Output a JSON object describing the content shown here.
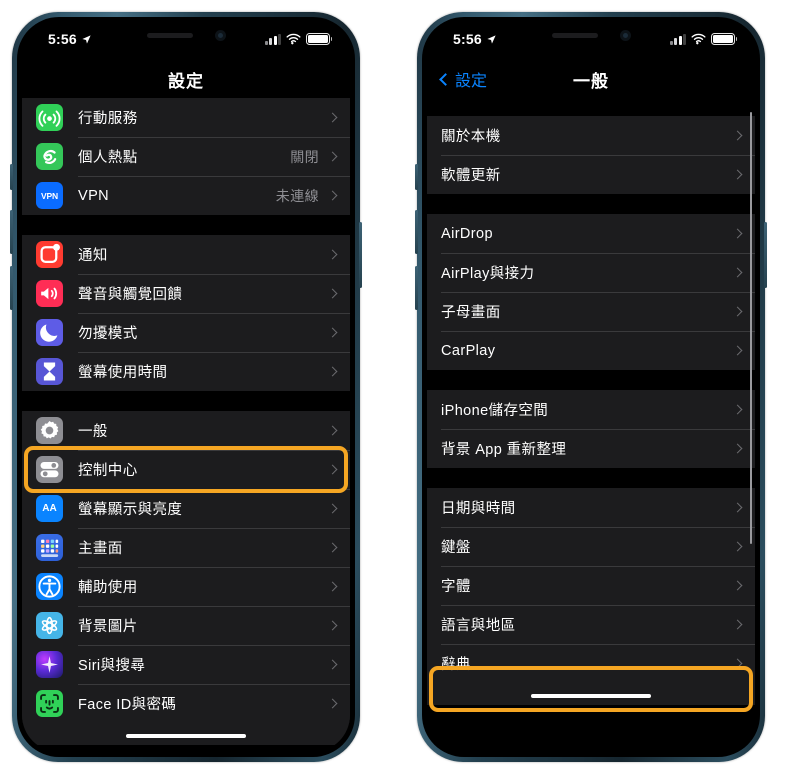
{
  "meta": {
    "platform": "ios-settings-screenshot",
    "accent_highlight_color": "#f5a623",
    "list_bg_color": "#1c1c1e",
    "link_color": "#0a84ff"
  },
  "phones": [
    {
      "id": "left-phone",
      "status_bar": {
        "time": "5:56",
        "location_arrow": "location-arrow-icon",
        "signal": "cellular-bars-icon",
        "wifi": "wifi-icon",
        "battery": "battery-icon"
      },
      "title": "設定",
      "groups": [
        {
          "rows": [
            {
              "icon": "cellular-icon",
              "label": "行動服務",
              "value": "",
              "chevron": true
            },
            {
              "icon": "hotspot-icon",
              "label": "個人熱點",
              "value": "關閉",
              "chevron": true
            },
            {
              "icon": "vpn-icon",
              "label": "VPN",
              "value": "未連線",
              "chevron": true
            }
          ]
        },
        {
          "rows": [
            {
              "icon": "notifications-icon",
              "label": "通知",
              "value": "",
              "chevron": true
            },
            {
              "icon": "sound-haptics-icon",
              "label": "聲音與觸覺回饋",
              "value": "",
              "chevron": true
            },
            {
              "icon": "do-not-disturb-icon",
              "label": "勿擾模式",
              "value": "",
              "chevron": true
            },
            {
              "icon": "screen-time-icon",
              "label": "螢幕使用時間",
              "value": "",
              "chevron": true
            }
          ]
        },
        {
          "rows": [
            {
              "icon": "general-gear-icon",
              "label": "一般",
              "value": "",
              "chevron": true,
              "highlighted": true
            },
            {
              "icon": "control-center-icon",
              "label": "控制中心",
              "value": "",
              "chevron": true
            },
            {
              "icon": "display-brightness-icon",
              "label": "螢幕顯示與亮度",
              "value": "",
              "chevron": true
            },
            {
              "icon": "home-screen-icon",
              "label": "主畫面",
              "value": "",
              "chevron": true
            },
            {
              "icon": "accessibility-icon",
              "label": "輔助使用",
              "value": "",
              "chevron": true
            },
            {
              "icon": "wallpaper-icon",
              "label": "背景圖片",
              "value": "",
              "chevron": true
            },
            {
              "icon": "siri-icon",
              "label": "Siri與搜尋",
              "value": "",
              "chevron": true
            },
            {
              "icon": "face-id-icon",
              "label": "Face ID與密碼",
              "value": "",
              "chevron": true
            }
          ]
        }
      ]
    },
    {
      "id": "right-phone",
      "status_bar": {
        "time": "5:56",
        "location_arrow": "location-arrow-icon",
        "signal": "cellular-bars-icon",
        "wifi": "wifi-icon",
        "battery": "battery-icon"
      },
      "nav": {
        "back_label": "設定",
        "title": "一般"
      },
      "groups": [
        {
          "rows": [
            {
              "label": "關於本機",
              "chevron": true
            },
            {
              "label": "軟體更新",
              "chevron": true
            }
          ]
        },
        {
          "rows": [
            {
              "label": "AirDrop",
              "chevron": true
            },
            {
              "label": "AirPlay與接力",
              "chevron": true
            },
            {
              "label": "子母畫面",
              "chevron": true
            },
            {
              "label": "CarPlay",
              "chevron": true
            }
          ]
        },
        {
          "rows": [
            {
              "label": "iPhone儲存空間",
              "chevron": true
            },
            {
              "label": "背景 App 重新整理",
              "chevron": true
            }
          ]
        },
        {
          "rows": [
            {
              "label": "日期與時間",
              "chevron": true
            },
            {
              "label": "鍵盤",
              "chevron": true
            },
            {
              "label": "字體",
              "chevron": true
            },
            {
              "label": "語言與地區",
              "chevron": true,
              "highlighted": true
            },
            {
              "label": "辭典",
              "chevron": true
            }
          ]
        }
      ]
    }
  ]
}
